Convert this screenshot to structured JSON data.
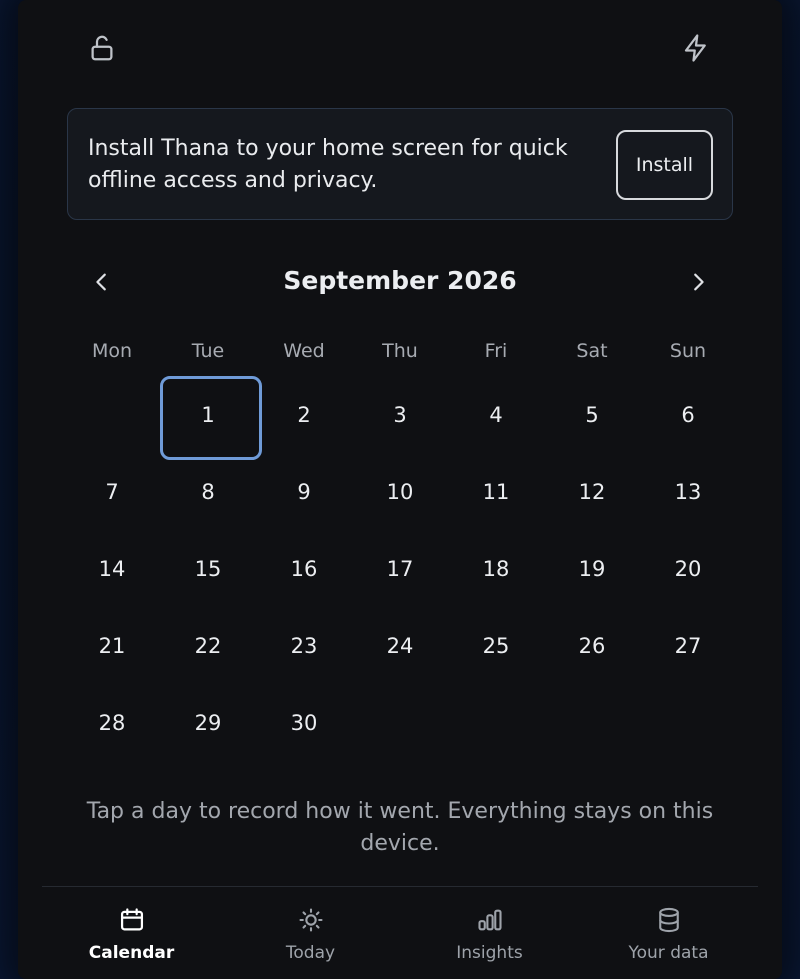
{
  "topbar": {
    "lock_icon": "unlocked-padlock-icon",
    "bolt_icon": "lightning-bolt-icon"
  },
  "install_banner": {
    "message": "Install Thana to your home screen for quick offline access and privacy.",
    "button_label": "Install"
  },
  "calendar": {
    "month_label": "September 2026",
    "prev_icon": "chevron-left-icon",
    "next_icon": "chevron-right-icon",
    "weekdays": [
      "Mon",
      "Tue",
      "Wed",
      "Thu",
      "Fri",
      "Sat",
      "Sun"
    ],
    "leading_blanks": 1,
    "days": [
      "1",
      "2",
      "3",
      "4",
      "5",
      "6",
      "7",
      "8",
      "9",
      "10",
      "11",
      "12",
      "13",
      "14",
      "15",
      "16",
      "17",
      "18",
      "19",
      "20",
      "21",
      "22",
      "23",
      "24",
      "25",
      "26",
      "27",
      "28",
      "29",
      "30"
    ],
    "selected_day": "1"
  },
  "hint": "Tap a day to record how it went. Everything stays on this device.",
  "bottom_nav": {
    "items": [
      {
        "label": "Calendar",
        "icon": "calendar-icon",
        "active": true
      },
      {
        "label": "Today",
        "icon": "sun-icon",
        "active": false
      },
      {
        "label": "Insights",
        "icon": "bar-chart-icon",
        "active": false
      },
      {
        "label": "Your data",
        "icon": "database-icon",
        "active": false
      }
    ]
  },
  "colors": {
    "background": "#0f1013",
    "accent_outline": "#6f9bd8",
    "banner_border": "#2a3648"
  }
}
